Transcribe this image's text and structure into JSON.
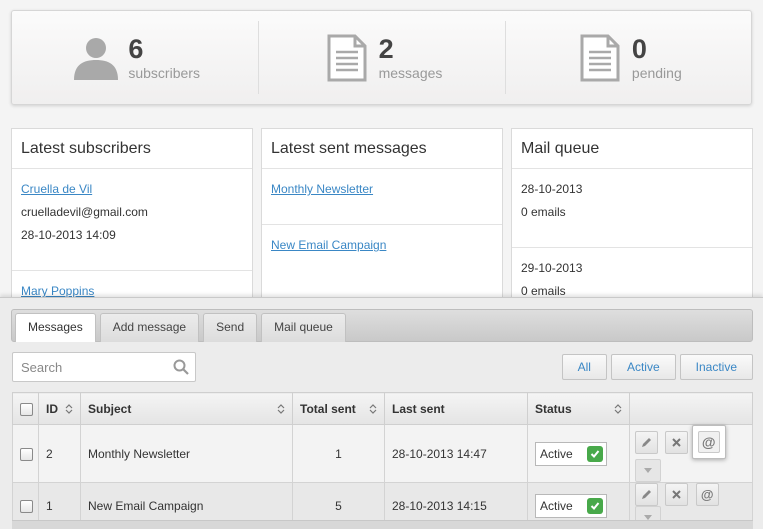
{
  "stats": [
    {
      "icon": "user-icon",
      "value": "6",
      "label": "subscribers"
    },
    {
      "icon": "document-icon",
      "value": "2",
      "label": "messages"
    },
    {
      "icon": "document-icon",
      "value": "0",
      "label": "pending"
    }
  ],
  "panels": {
    "subscribers": {
      "title": "Latest subscribers",
      "items": [
        {
          "name": "Cruella de Vil",
          "email": "cruelladevil@gmail.com",
          "date": "28-10-2013 14:09"
        },
        {
          "name": "Mary Poppins"
        }
      ]
    },
    "messages": {
      "title": "Latest sent messages",
      "items": [
        "Monthly Newsletter",
        "New Email Campaign"
      ]
    },
    "queue": {
      "title": "Mail queue",
      "items": [
        {
          "date": "28-10-2013",
          "count": "0 emails"
        },
        {
          "date": "29-10-2013",
          "count": "0 emails"
        }
      ]
    }
  },
  "tabs": [
    "Messages",
    "Add message",
    "Send",
    "Mail queue"
  ],
  "search": {
    "placeholder": "Search"
  },
  "filters": [
    "All",
    "Active",
    "Inactive"
  ],
  "table": {
    "columns": [
      "ID",
      "Subject",
      "Total sent",
      "Last sent",
      "Status"
    ],
    "rows": [
      {
        "id": "2",
        "subject": "Monthly Newsletter",
        "total": "1",
        "last_sent": "28-10-2013 14:47",
        "status": "Active"
      },
      {
        "id": "1",
        "subject": "New Email Campaign",
        "total": "5",
        "last_sent": "28-10-2013 14:15",
        "status": "Active"
      }
    ]
  },
  "colors": {
    "accent": "#3a87c5",
    "active_check": "#48a94a"
  }
}
